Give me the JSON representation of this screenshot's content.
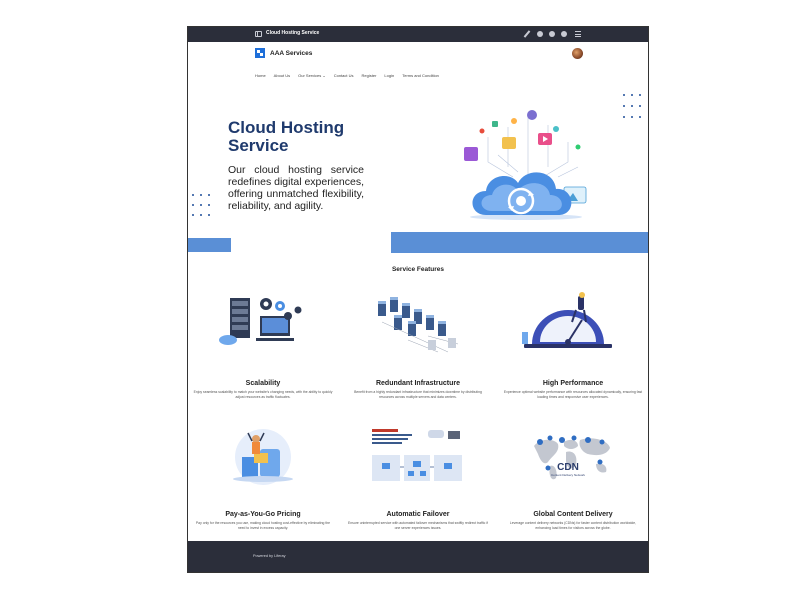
{
  "appbar": {
    "title": "Cloud Hosting Service",
    "icons": [
      "panel-icon",
      "pencil-icon",
      "gear-icon",
      "globe-icon",
      "info-icon",
      "grid-menu-icon"
    ]
  },
  "header": {
    "site_name": "AAA Services",
    "logo_icon": "logo-icon",
    "avatar_icon": "user-avatar",
    "nav": [
      "Home",
      "About Us",
      "Our Services ⌄",
      "Contact Us",
      "Register",
      "Login",
      "Terms and Condition"
    ]
  },
  "hero": {
    "title": "Cloud Hosting Service",
    "text": "Our cloud hosting service redefines digital experiences, offering unmatched flexibility, reliability, and agility.",
    "accent": "#5a8fd6",
    "title_color": "#1f3a6d"
  },
  "features": {
    "title": "Service Features",
    "items": [
      {
        "name": "Scalability",
        "desc": "Enjoy seamless scalability to match your website's changing needs, with the ability to quickly adjust resources as traffic fluctuates."
      },
      {
        "name": "Redundant Infrastructure",
        "desc": "Benefit from a highly redundant infrastructure that minimizes downtime by distributing resources across multiple servers and data centers."
      },
      {
        "name": "High Performance",
        "desc": "Experience optimal website performance with resources allocated dynamically, ensuring fast loading times and responsive user experiences."
      },
      {
        "name": "Pay-as-You-Go Pricing",
        "desc": "Pay only for the resources you use, making cloud hosting cost-effective by eliminating the need to invest in excess capacity."
      },
      {
        "name": "Automatic Failover",
        "desc": "Ensure uninterrupted service with automated failover mechanisms that swiftly redirect traffic if one server experiences issues."
      },
      {
        "name": "Global Content Delivery",
        "desc": "Leverage content delivery networks (CDNs) for faster content distribution worldwide, enhancing load times for visitors across the globe."
      }
    ],
    "cdn_label": "CDN",
    "cdn_sub": "Content Delivery Network"
  },
  "footer": {
    "text": "Powered by Liferay"
  }
}
